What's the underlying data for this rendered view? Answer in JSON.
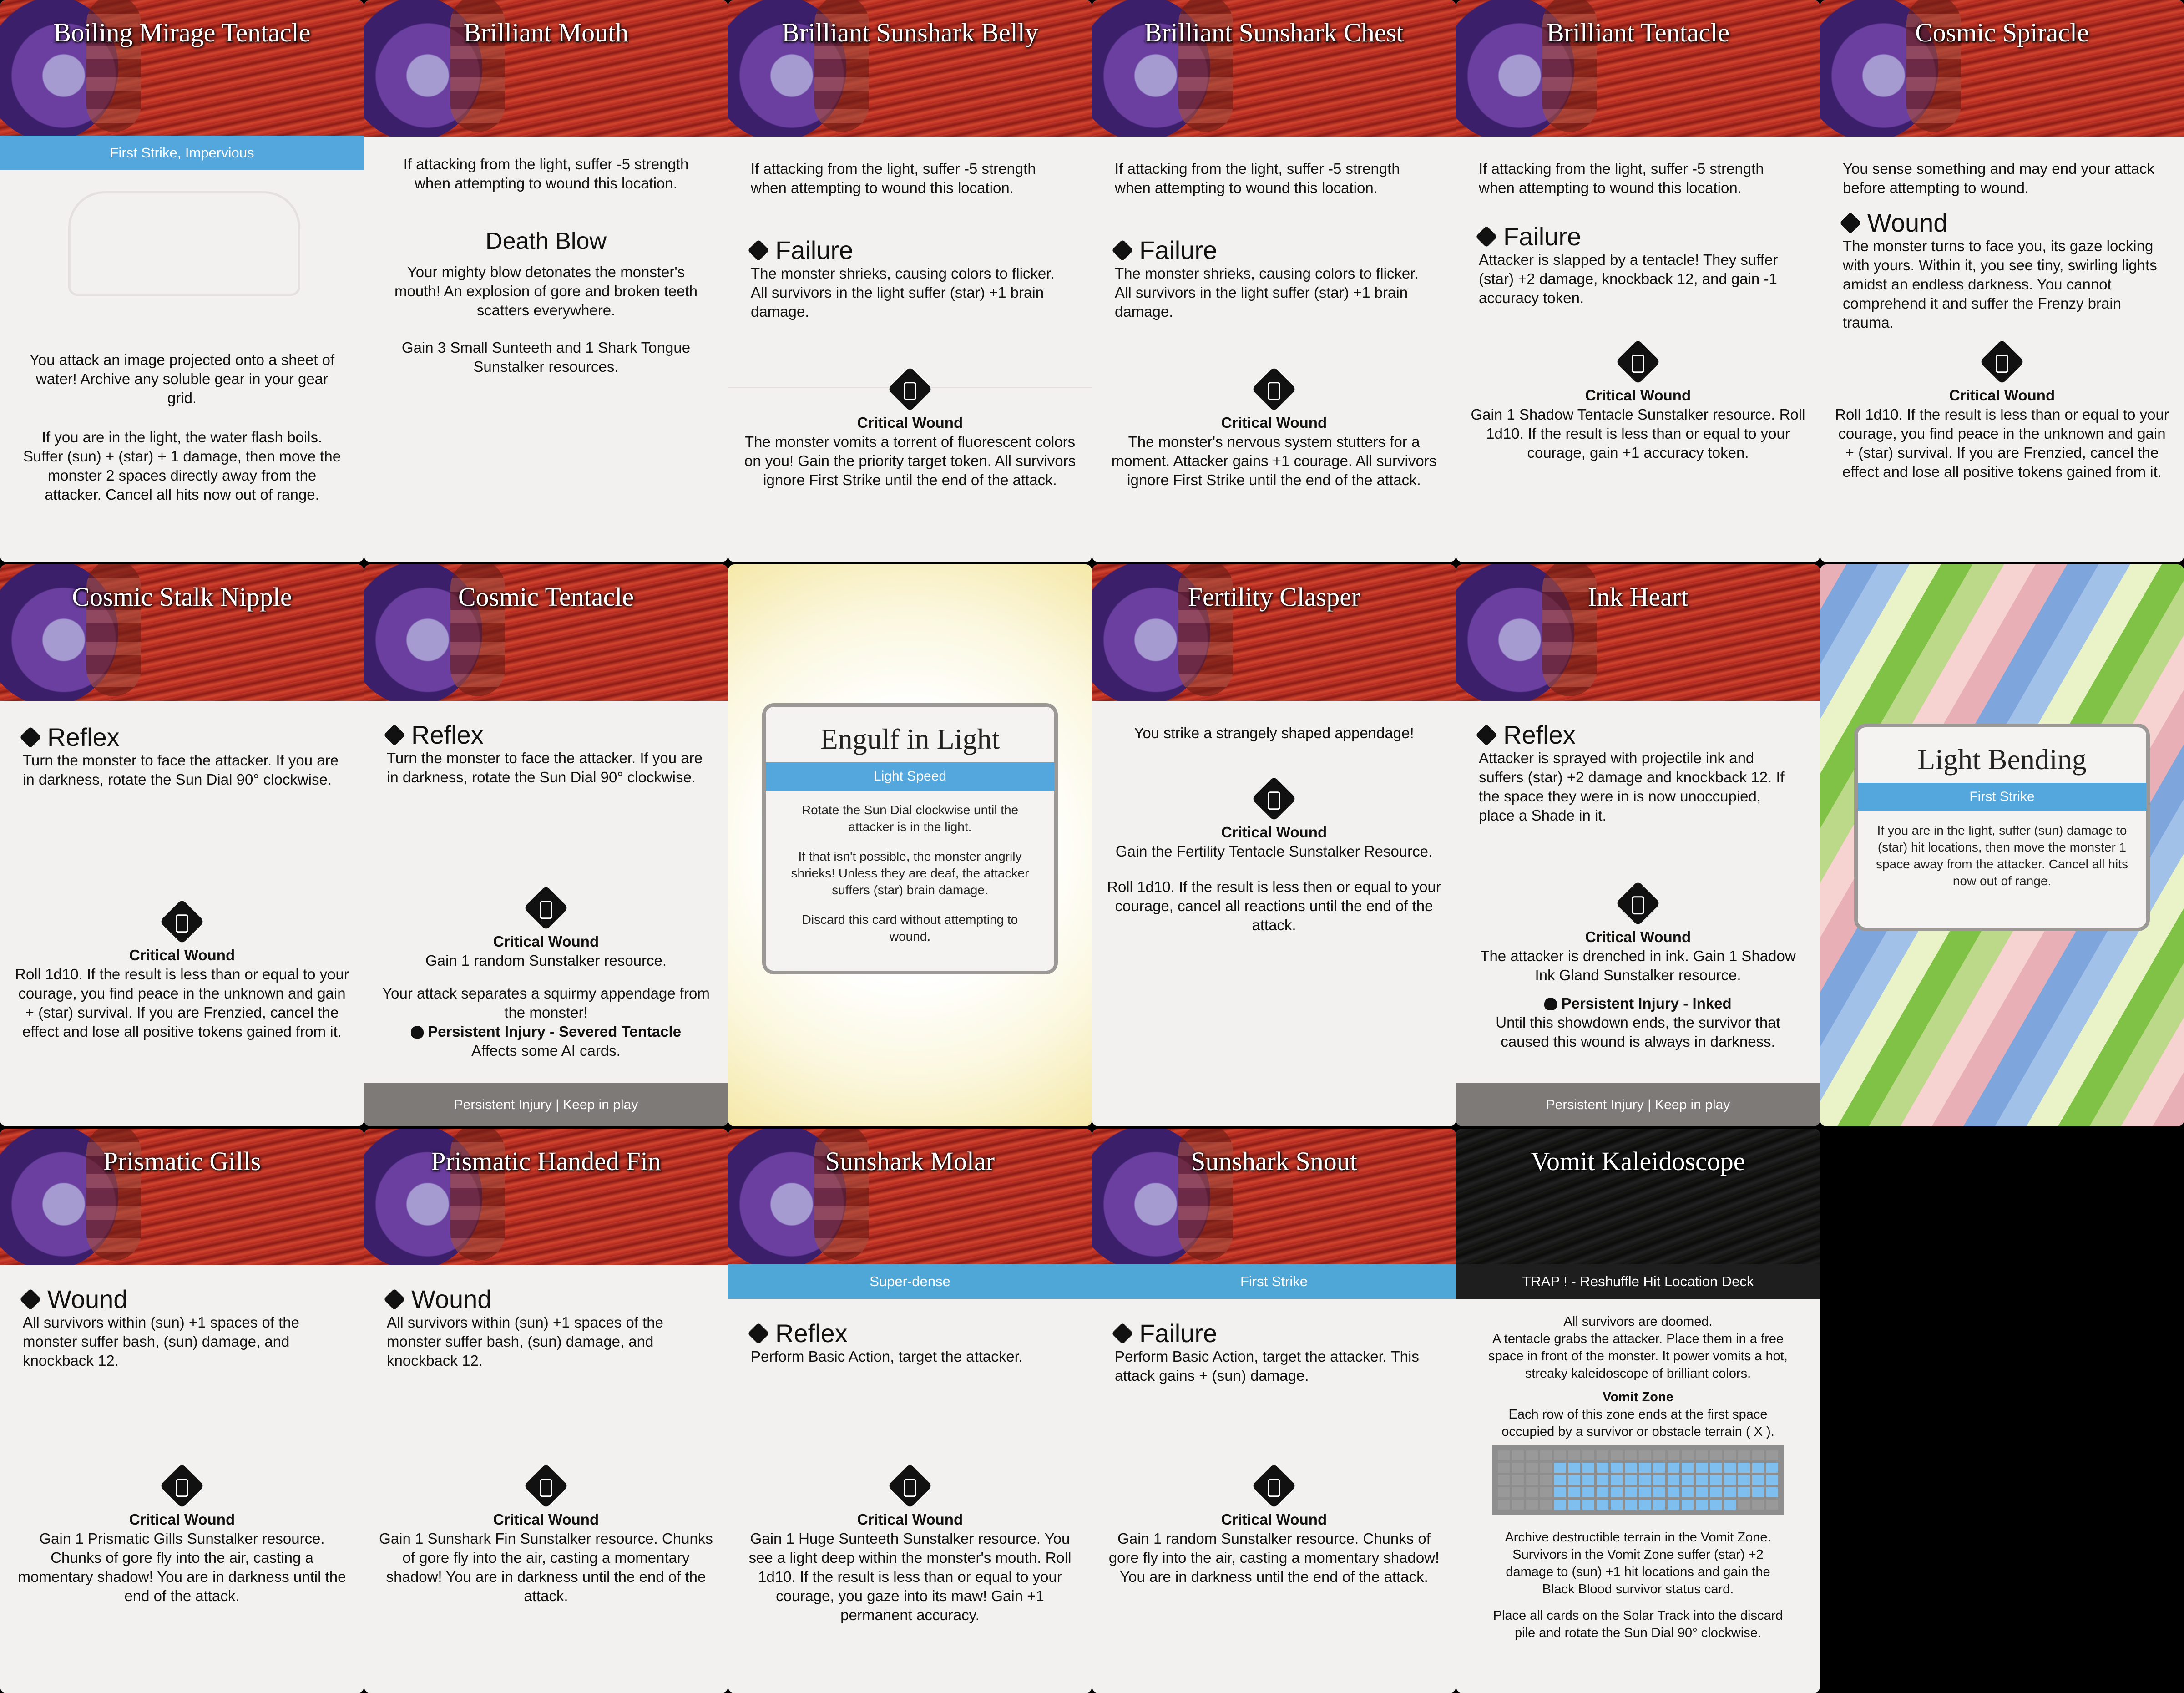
{
  "cards": [
    {
      "id": "c1",
      "title": "Boiling Mirage Tentacle",
      "band": "First Strike, Impervious",
      "text_a": "You attack an image projected onto a sheet of water! Archive any soluble gear in your gear grid.",
      "text_b": "If you are in the light, the water flash boils. Suffer (sun) + (star) + 1 damage, then move the monster 2 spaces directly away from the attacker. Cancel all hits now out of range."
    },
    {
      "id": "c2",
      "title": "Brilliant Mouth",
      "text_a": "If attacking from the light, suffer -5 strength when attempting to wound this location.",
      "heading": "Death Blow",
      "text_b": "Your mighty blow detonates the monster's mouth! An explosion of gore and broken teeth scatters everywhere.",
      "text_c": "Gain 3 Small Sunteeth and 1 Shark Tongue Sunstalker resources."
    },
    {
      "id": "c3",
      "title": "Brilliant Sunshark Belly",
      "text_a": "If attacking from the light, suffer -5 strength when attempting to wound this location.",
      "kw": "Failure",
      "kw_text": "The monster shrieks, causing colors to flicker. All survivors in the light suffer (star) +1 brain damage.",
      "crit_title": "Critical Wound",
      "crit_text": "The monster vomits a torrent of fluorescent colors on you! Gain the priority target token. All survivors ignore First Strike until the end of the attack."
    },
    {
      "id": "c4",
      "title": "Brilliant Sunshark Chest",
      "text_a": "If attacking from the light, suffer -5 strength when attempting to wound this location.",
      "kw": "Failure",
      "kw_text": "The monster shrieks, causing colors to flicker. All survivors in the light suffer (star) +1 brain damage.",
      "crit_title": "Critical Wound",
      "crit_text": "The monster's nervous system stutters for a moment. Attacker gains +1 courage. All survivors ignore First Strike until the end of the attack."
    },
    {
      "id": "c5",
      "title": "Brilliant Tentacle",
      "text_a": "If attacking from the light, suffer -5 strength when attempting to wound this location.",
      "kw": "Failure",
      "kw_text": "Attacker is slapped by a tentacle! They suffer (star) +2 damage, knockback 12, and gain -1 accuracy token.",
      "crit_title": "Critical Wound",
      "crit_text": "Gain 1 Shadow Tentacle Sunstalker resource. Roll 1d10. If the result is less than or equal to your courage, gain +1 accuracy token."
    },
    {
      "id": "c6",
      "title": "Cosmic Spiracle",
      "text_a": "You sense something and may end your attack before attempting to wound.",
      "kw": "Wound",
      "kw_text": "The monster turns to face you, its gaze locking with yours. Within it, you see tiny, swirling lights amidst an endless darkness. You cannot comprehend it and suffer the Frenzy brain trauma.",
      "crit_title": "Critical Wound",
      "crit_text": "Roll 1d10. If the result is less than or equal to your courage, you find peace in the unknown and gain + (star) survival. If you are Frenzied, cancel the effect and lose all positive tokens gained from it."
    },
    {
      "id": "c7",
      "title": "Cosmic Stalk Nipple",
      "kw": "Reflex",
      "kw_text": "Turn the monster to face the attacker. If you are in darkness, rotate the Sun Dial 90° clockwise.",
      "crit_title": "Critical Wound",
      "crit_text": "Roll 1d10. If the result is less than or equal to your courage, you find peace in the unknown and gain + (star) survival. If you are Frenzied, cancel the effect and lose all positive tokens gained from it."
    },
    {
      "id": "c8",
      "title": "Cosmic Tentacle",
      "kw": "Reflex",
      "kw_text": "Turn the monster to face the attacker. If you are in darkness, rotate the Sun Dial 90° clockwise.",
      "crit_title": "Critical Wound",
      "crit_text": "Gain 1 random Sunstalker resource.",
      "crit_text2": "Your attack separates a squirmy appendage from the monster!",
      "persist_line": "Persistent Injury - Severed Tentacle",
      "persist_line2": "Affects some AI cards.",
      "footer": "Persistent Injury | Keep in play"
    },
    {
      "id": "c9",
      "title": "Engulf in Light",
      "band": "Light Speed",
      "text": "Rotate the Sun Dial clockwise until the attacker is in the light.",
      "text2": "If that isn't possible, the monster angrily shrieks! Unless they are deaf, the attacker suffers (star) brain damage.",
      "text3": "Discard this card without attempting to wound."
    },
    {
      "id": "c10",
      "title": "Fertility Clasper",
      "text_a": "You strike a strangely shaped appendage!",
      "crit_title": "Critical Wound",
      "crit_text": "Gain the Fertility Tentacle Sunstalker Resource.",
      "crit_text2": "Roll 1d10. If the result is less then or equal to your courage, cancel all reactions until the end of the attack."
    },
    {
      "id": "c11",
      "title": "Ink Heart",
      "kw": "Reflex",
      "kw_text": "Attacker is sprayed with projectile ink and suffers (star) +2 damage and knockback 12. If the space they were in is now unoccupied, place a Shade in it.",
      "crit_title": "Critical Wound",
      "crit_text": "The attacker is drenched in ink. Gain 1 Shadow Ink Gland Sunstalker resource.",
      "persist_line": "Persistent Injury - Inked",
      "persist_line2": "Until this showdown ends, the survivor that caused this wound is always in darkness.",
      "footer": "Persistent Injury | Keep in play"
    },
    {
      "id": "c12",
      "title": "Light Bending",
      "band": "First Strike",
      "text": "If you are in the light, suffer (sun) damage to (star) hit locations, then move the monster 1 space away from the attacker. Cancel all hits now out of range."
    },
    {
      "id": "c13",
      "title": "Prismatic Gills",
      "kw": "Wound",
      "kw_text": "All survivors within (sun) +1 spaces of the monster suffer bash, (sun) damage, and knockback 12.",
      "crit_title": "Critical Wound",
      "crit_text": "Gain 1 Prismatic Gills Sunstalker resource. Chunks of gore fly into the air, casting a momentary shadow! You are in darkness until the end of the attack."
    },
    {
      "id": "c14",
      "title": "Prismatic Handed Fin",
      "kw": "Wound",
      "kw_text": "All survivors within (sun) +1 spaces of the monster suffer bash, (sun) damage, and knockback 12.",
      "crit_title": "Critical Wound",
      "crit_text": "Gain 1 Sunshark Fin Sunstalker resource. Chunks of gore fly into the air, casting a momentary shadow! You are in darkness until the end of the attack."
    },
    {
      "id": "c15",
      "title": "Sunshark Molar",
      "band": "Super-dense",
      "kw": "Reflex",
      "kw_text": "Perform Basic Action, target the attacker.",
      "crit_title": "Critical Wound",
      "crit_text": "Gain 1 Huge Sunteeth Sunstalker resource. You see a light deep within the monster's mouth. Roll 1d10. If the result is less than or equal to your courage, you gaze into its maw! Gain +1 permanent accuracy."
    },
    {
      "id": "c16",
      "title": "Sunshark Snout",
      "band": "First Strike",
      "kw": "Failure",
      "kw_text": "Perform Basic Action, target the attacker. This attack gains + (sun) damage.",
      "crit_title": "Critical Wound",
      "crit_text": "Gain 1 random Sunstalker resource. Chunks of gore fly into the air, casting a momentary shadow! You are in darkness until the end of the attack."
    },
    {
      "id": "c17",
      "title": "Vomit Kaleidoscope",
      "band": "TRAP ! - Reshuffle Hit Location Deck",
      "text": "All survivors are doomed.",
      "text2": "A tentacle grabs the attacker. Place them in a free space in front of the monster. It power vomits a hot, streaky kaleidoscope of brilliant colors.",
      "zone_title": "Vomit Zone",
      "zone_text": "Each row of this zone ends at the first space occupied by a survivor or obstacle terrain ( X ).",
      "text3": "Archive destructible terrain in the Vomit Zone. Survivors in the Vomit Zone suffer (star) +2 damage to (sun) +1 hit locations and gain the Black Blood survivor status card.",
      "text4": "Place all cards on the Solar Track into the discard pile and rotate the Sun Dial 90° clockwise."
    }
  ]
}
